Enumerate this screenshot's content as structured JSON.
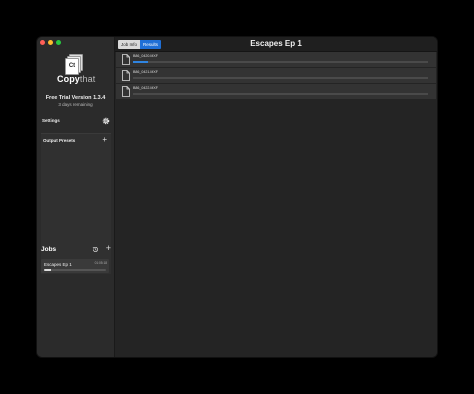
{
  "sidebar": {
    "logo_text_bold": "Copy",
    "logo_text_light": "that",
    "logo_box_letters": "Ct",
    "version": "Free Trial Version 1.3.4",
    "remaining": "3 days remaining",
    "settings_label": "Settings",
    "presets_label": "Output Presets",
    "presets_add": "+",
    "jobs_label": "Jobs",
    "jobs_add": "+",
    "jobs": [
      {
        "name": "Escapes Ep 1",
        "time": "01:05:18",
        "progress": 0.12
      }
    ]
  },
  "toolbar": {
    "tab_job_info": "Job Info",
    "tab_results": "Results",
    "title": "Escapes Ep 1"
  },
  "files": [
    {
      "name": "B86_0420.MXF",
      "progress": 0.05
    },
    {
      "name": "B86_0421.MXF",
      "progress": 0.0
    },
    {
      "name": "B86_0422.MXF",
      "progress": 0.0
    }
  ],
  "colors": {
    "accent": "#1f6fd6",
    "progress": "#2f84e0"
  }
}
